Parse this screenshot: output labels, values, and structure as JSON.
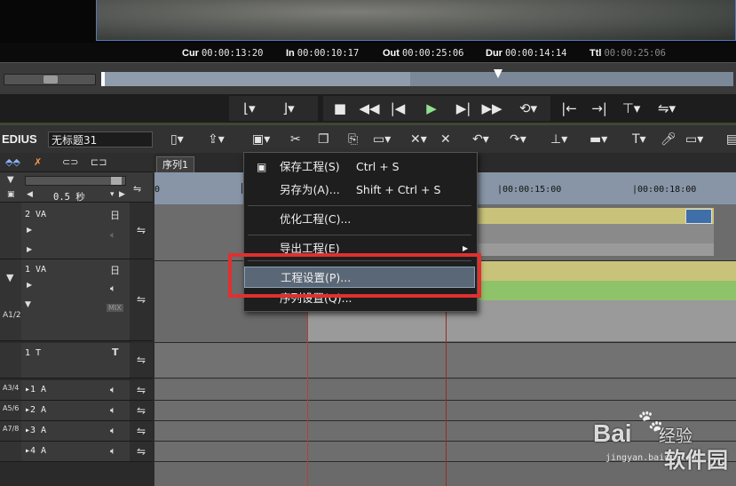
{
  "timecodes": {
    "cur_label": "Cur",
    "cur": "00:00:13:20",
    "in_label": "In",
    "in": "00:00:10:17",
    "out_label": "Out",
    "out": "00:00:25:06",
    "dur_label": "Dur",
    "dur": "00:00:14:14",
    "ttl_label": "Ttl",
    "ttl": "00:00:25:06"
  },
  "toolbar": {
    "app_name": "EDIUS",
    "project_name": "无标题31"
  },
  "left_panel": {
    "zoom_label": "0.5 秒",
    "tracks": [
      {
        "label": "2 VA",
        "badge": "日"
      },
      {
        "label": "1 VA",
        "badge": "日",
        "mix": "MIX"
      },
      {
        "label": "1 T",
        "badge": "T"
      },
      {
        "label": "▸1 A",
        "side": "A3/4"
      },
      {
        "label": "▸2 A",
        "side": "A5/6"
      },
      {
        "label": "▸3 A",
        "side": "A7/8"
      },
      {
        "label": "▸4 A",
        "side": ""
      }
    ],
    "side_a12": "A1/2"
  },
  "timeline": {
    "sequence_tab": "序列1",
    "ruler_labels": [
      "0",
      "|00:00:15:00",
      "|00:00:18:00"
    ]
  },
  "context_menu": {
    "items": [
      {
        "label": "保存工程(S)",
        "shortcut": "Ctrl + S",
        "icon": "save-icon"
      },
      {
        "label": "另存为(A)...",
        "shortcut": "Shift + Ctrl + S"
      },
      {
        "label": "优化工程(C)..."
      },
      {
        "label": "导出工程(E)",
        "submenu": true
      },
      {
        "label": "工程设置(P)...",
        "highlighted": true
      },
      {
        "label": "序列设置(Q)..."
      }
    ]
  },
  "watermark": {
    "brand": "Bai",
    "brand_cn": "经验",
    "url": "jingyan.baidu.com",
    "site": "软件园"
  },
  "colors": {
    "highlight_box": "#e03030",
    "clip_yellow": "#c9c27a",
    "clip_green": "#8fc36a",
    "ruler": "#8795a6",
    "play_green": "#8fe08f"
  }
}
